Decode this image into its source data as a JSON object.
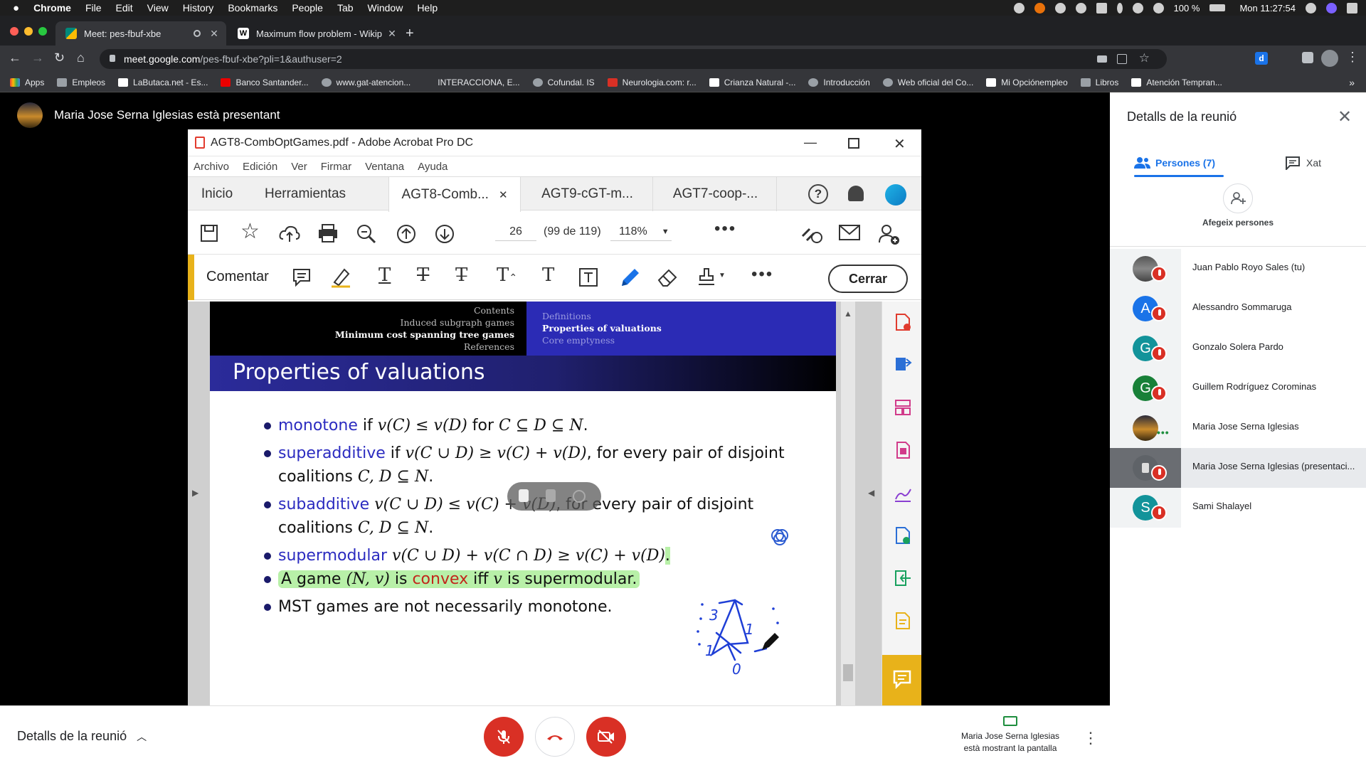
{
  "menubar": {
    "app": "Chrome",
    "items": [
      "File",
      "Edit",
      "View",
      "History",
      "Bookmarks",
      "People",
      "Tab",
      "Window",
      "Help"
    ],
    "battery": "100 %",
    "clock": "Mon 11:27:54"
  },
  "tabs": [
    {
      "title": "Meet: pes-fbuf-xbe",
      "favicon_color": "#00897b"
    },
    {
      "title": "Maximum flow problem - Wikip",
      "favicon_color": "#ffffff"
    }
  ],
  "address": {
    "host": "meet.google.com",
    "path": "/pes-fbuf-xbe?pli=1&authuser=2"
  },
  "bookmarks": [
    "Apps",
    "Empleos",
    "LaButaca.net - Es...",
    "Banco Santander...",
    "www.gat-atencion...",
    "INTERACCIONA, E...",
    "Cofundal. IS",
    "Neurologia.com: r...",
    "Crianza Natural -...",
    "Introducción",
    "Web oficial del Co...",
    "Mi Opciónempleo",
    "Libros",
    "Atención Tempran..."
  ],
  "presenter_banner": "Maria Jose Serna Iglesias està presentant",
  "acrobat": {
    "window_title": "AGT8-CombOptGames.pdf - Adobe Acrobat Pro DC",
    "menu": [
      "Archivo",
      "Edición",
      "Ver",
      "Firmar",
      "Ventana",
      "Ayuda"
    ],
    "tabs": {
      "home": "Inicio",
      "tools": "Herramientas",
      "doc1": "AGT8-Comb...",
      "doc2": "AGT9-cGT-m...",
      "doc3": "AGT7-coop-..."
    },
    "page_number": "26",
    "page_count": "(99 de 119)",
    "zoom": "118%",
    "comment_label": "Comentar",
    "close_button": "Cerrar"
  },
  "slide": {
    "nav_left": {
      "contents": "Contents",
      "induced": "Induced subgraph games",
      "current": "Minimum cost spanning tree games",
      "references": "References"
    },
    "nav_right": {
      "definitions": "Definitions",
      "current": "Properties of valuations",
      "core": "Core emptyness"
    },
    "title": "Properties of valuations",
    "items": {
      "i1": {
        "kw": "monotone",
        "t1": " if ",
        "m1": "v(C) ≤ v(D)",
        "t2": " for ",
        "m2": "C ⊆ D ⊆ N",
        "t3": "."
      },
      "i2": {
        "kw": "superadditive",
        "t1": " if ",
        "m1": "v(C ∪ D) ≥ v(C) + v(D)",
        "t2": ", for every pair of disjoint coalitions ",
        "m2": "C, D ⊆ N",
        "t3": "."
      },
      "i3": {
        "kw": "subadditive",
        "t1": " ",
        "m1": "v(C ∪ D) ≤ v(C) + v(D)",
        "t2": ", for every pair of disjoint coalitions ",
        "m2": "C, D ⊆ N",
        "t3": "."
      },
      "i4": {
        "kw": "supermodular",
        "t1": " ",
        "m1": "v(C ∪ D) + v(C ∩ D) ≥ v(C) + v(D)",
        "t3": "."
      },
      "i5": {
        "t1": "A game ",
        "m1": "(N, v)",
        "t2": " is ",
        "red": "convex",
        "t3": " iff ",
        "m2": "v",
        "t4": " is supermodular."
      },
      "i6": {
        "t1": "MST games are not necessarily monotone."
      }
    },
    "handwriting": [
      "3",
      "1",
      "1",
      "0"
    ]
  },
  "bottom": {
    "details": "Detalls de la reunió",
    "presenting_note": "Maria Jose Serna Iglesias està mostrant la pantalla",
    "mute_color": "#d93025"
  },
  "panel": {
    "title": "Detalls de la reunió",
    "people_tab": "Persones (7)",
    "chat_tab": "Xat",
    "add_people": "Afegeix persones",
    "participants": [
      {
        "initial": "",
        "name": "Juan Pablo Royo Sales (tu)",
        "color": "#7a7a7a"
      },
      {
        "initial": "A",
        "name": "Alessandro Sommaruga",
        "color": "#1a73e8"
      },
      {
        "initial": "G",
        "name": "Gonzalo Solera Pardo",
        "color": "#12939a"
      },
      {
        "initial": "G",
        "name": "Guillem Rodríguez Corominas",
        "color": "#188038"
      },
      {
        "initial": "",
        "name": "Maria Jose Serna Iglesias",
        "color": "#c98a2b"
      },
      {
        "initial": "",
        "name": "Maria Jose Serna Iglesias (presentaci...",
        "color": "#5f6368"
      },
      {
        "initial": "S",
        "name": "Sami Shalayel",
        "color": "#12939a"
      }
    ]
  }
}
